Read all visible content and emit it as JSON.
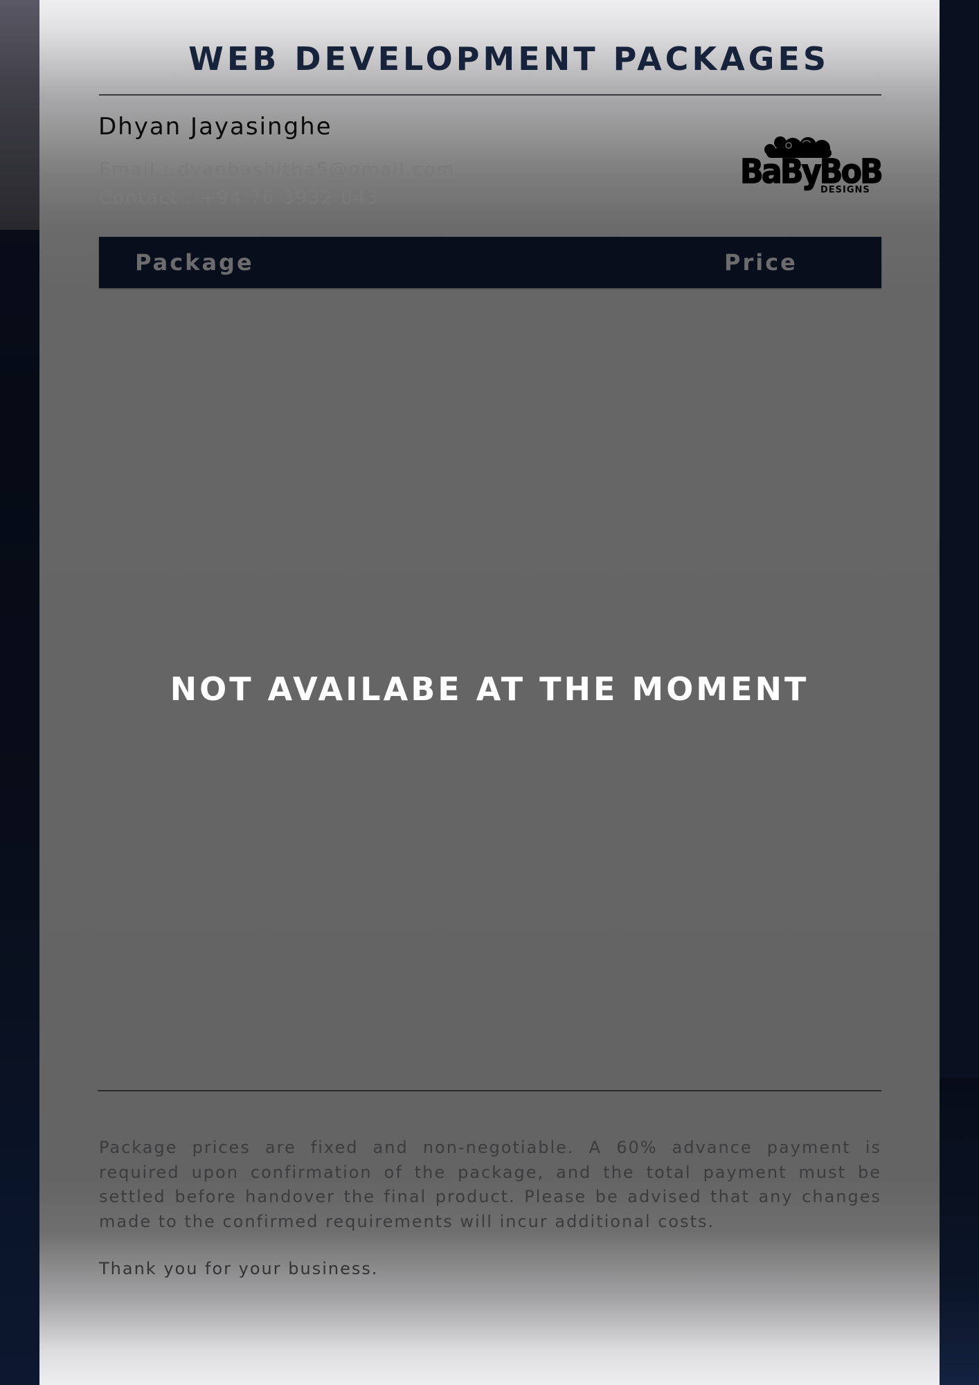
{
  "document": {
    "title": "WEB DEVELOPMENT PACKAGES",
    "name": "Dhyan Jayasinghe",
    "email_line": "Email : dyanbashitha5@gmail.com",
    "contact_line": "Contact : +94 76 3932 043",
    "logo": {
      "icon": "babybob-designs-logo",
      "main_text": "BaByBoB",
      "sub_text": "DESIGNS"
    }
  },
  "table": {
    "columns": [
      "Package",
      "Price"
    ]
  },
  "notice": "NOT AVAILABE AT THE MOMENT",
  "footer": {
    "terms": "Package prices are fixed and non-negotiable. A 60% advance payment is required upon confirmation of the package, and the total payment must be settled before handover the final product. Please be advised that any changes made to the confirmed requirements will incur additional costs.",
    "thanks": "Thank you for your business."
  },
  "colors": {
    "title": "#17233a",
    "header_bar": "#080e1b",
    "notice_text": "#ffffff"
  }
}
